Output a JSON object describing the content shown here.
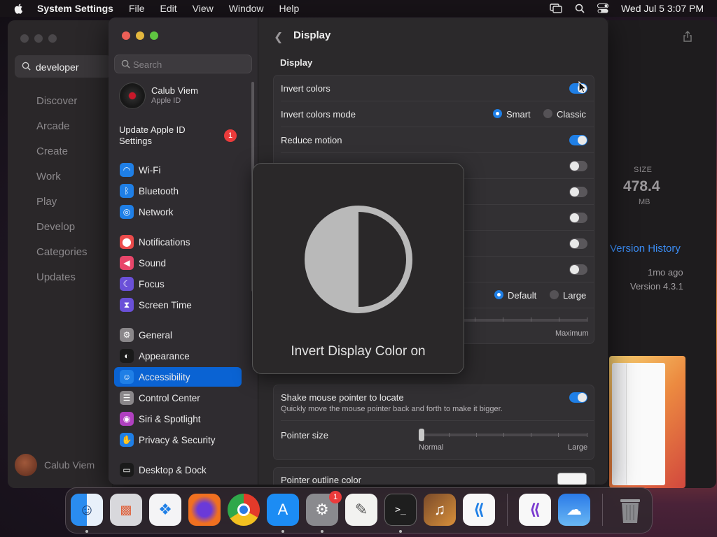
{
  "menubar": {
    "app_name": "System Settings",
    "items": [
      "File",
      "Edit",
      "View",
      "Window",
      "Help"
    ],
    "clock": "Wed Jul 5  3:07 PM"
  },
  "appstore": {
    "search_value": "developer",
    "nav": [
      "Discover",
      "Arcade",
      "Create",
      "Work",
      "Play",
      "Develop",
      "Categories",
      "Updates"
    ],
    "user_name": "Calub Viem",
    "size_label": "SIZE",
    "size_value": "478.4",
    "size_unit": "MB",
    "version_history": "Version History",
    "updated_ago": "1mo ago",
    "version": "Version 4.3.1"
  },
  "sidebar": {
    "search_placeholder": "Search",
    "account_name": "Calub Viem",
    "account_sub": "Apple ID",
    "update_label": "Update Apple ID Settings",
    "update_badge": "1",
    "items": [
      {
        "label": "Wi-Fi",
        "icon": "wifi-icon",
        "color": "#1f7fe6"
      },
      {
        "label": "Bluetooth",
        "icon": "bluetooth-icon",
        "color": "#1f7fe6"
      },
      {
        "label": "Network",
        "icon": "globe-icon",
        "color": "#1f7fe6"
      },
      {
        "label": "Notifications",
        "icon": "bell-icon",
        "color": "#eb4b4b"
      },
      {
        "label": "Sound",
        "icon": "speaker-icon",
        "color": "#e8466a"
      },
      {
        "label": "Focus",
        "icon": "moon-icon",
        "color": "#6a50d8"
      },
      {
        "label": "Screen Time",
        "icon": "hourglass-icon",
        "color": "#6a50d8"
      },
      {
        "label": "General",
        "icon": "gear-icon",
        "color": "#8a878a"
      },
      {
        "label": "Appearance",
        "icon": "appearance-icon",
        "color": "#1a1a1a"
      },
      {
        "label": "Accessibility",
        "icon": "accessibility-icon",
        "color": "#1f7fe6"
      },
      {
        "label": "Control Center",
        "icon": "control-center-icon",
        "color": "#8a878a"
      },
      {
        "label": "Siri & Spotlight",
        "icon": "siri-icon",
        "color": "#b040c0"
      },
      {
        "label": "Privacy & Security",
        "icon": "hand-icon",
        "color": "#1f7fe6"
      },
      {
        "label": "Desktop & Dock",
        "icon": "dock-icon",
        "color": "#1a1a1a"
      }
    ]
  },
  "main": {
    "title": "Display",
    "section": "Display",
    "rows": {
      "invert_colors": "Invert colors",
      "invert_mode": "Invert colors mode",
      "smart": "Smart",
      "classic": "Classic",
      "reduce_motion": "Reduce motion",
      "default": "Default",
      "large": "Large",
      "maximum": "Maximum",
      "shake_title": "Shake mouse pointer to locate",
      "shake_desc": "Quickly move the mouse pointer back and forth to make it bigger.",
      "pointer_size": "Pointer size",
      "normal": "Normal",
      "large2": "Large",
      "outline_color": "Pointer outline color"
    },
    "toggles": {
      "invert_colors": true,
      "reduce_motion": true,
      "shake": true
    }
  },
  "hud": {
    "text": "Invert Display Color on"
  },
  "dock": {
    "apps": [
      "Finder",
      "Launchpad",
      "Safari",
      "Firefox",
      "Chrome",
      "App Store",
      "System Settings",
      "TextEdit",
      "Terminal",
      "GarageBand",
      "Visual Studio Code",
      "Visual Studio",
      "Weather",
      "Trash"
    ],
    "settings_badge": "1"
  }
}
